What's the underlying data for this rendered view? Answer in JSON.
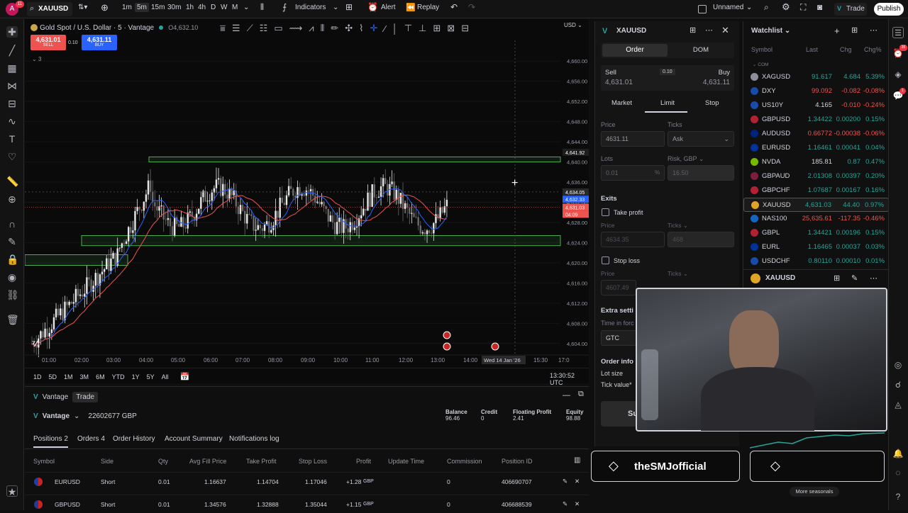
{
  "topbar": {
    "avatar_letter": "A",
    "notif_count": "11",
    "symbol": "XAUUSD",
    "intervals": [
      "1m",
      "5m",
      "15m",
      "30m",
      "1h",
      "4h",
      "D",
      "W",
      "M"
    ],
    "indicators": "Indicators",
    "alert": "Alert",
    "replay": "Replay",
    "layout_name": "Unnamed",
    "trade": "Trade",
    "publish": "Publish"
  },
  "chart": {
    "title": "Gold Spot / U.S. Dollar · 5 · Vantage",
    "ohlc": "O4,632.10",
    "sell_price": "4,631.01",
    "sell_label": "SELL",
    "spread": "0.10",
    "buy_price": "4,631.11",
    "buy_label": "BUY",
    "indicator_count": "3",
    "currency": "USD",
    "y_ticks": [
      "4,660.00",
      "4,656.00",
      "4,652.00",
      "4,648.00",
      "4,644.00",
      "4,640.00",
      "4,636.00",
      "4,632.00",
      "4,628.00",
      "4,624.00",
      "4,620.00",
      "4,616.00",
      "4,612.00",
      "4,608.00",
      "4,604.00"
    ],
    "price_tags": {
      "high": "4,641.92",
      "cross": "4,634.05",
      "bid": "4,632.33",
      "last": "4,631.03",
      "countdown": "04:09"
    },
    "x_ticks": [
      "01:00",
      "02:00",
      "03:00",
      "04:00",
      "05:00",
      "06:00",
      "07:00",
      "08:00",
      "09:00",
      "10:00",
      "11:00",
      "12:00",
      "13:00",
      "14:00",
      "15:30",
      "17:0"
    ],
    "cursor_date": "Wed 14 Jan '26",
    "range_buttons": [
      "1D",
      "5D",
      "1M",
      "3M",
      "6M",
      "YTD",
      "1Y",
      "5Y",
      "All"
    ],
    "clock": "13:30:52 UTC"
  },
  "tradepanel": {
    "broker": "Vantage",
    "trade_tab": "Trade",
    "account": "22602677 GBP",
    "stats": [
      {
        "label": "Balance",
        "value": "96.46"
      },
      {
        "label": "Credit",
        "value": "0"
      },
      {
        "label": "Floating Profit",
        "value": "2.41"
      },
      {
        "label": "Equity",
        "value": "98.88"
      }
    ],
    "tabs": [
      "Positions 2",
      "Orders 4",
      "Order History",
      "Account Summary",
      "Notifications log"
    ],
    "headers": [
      "Symbol",
      "Side",
      "Qty",
      "Avg Fill Price",
      "Take Profit",
      "Stop Loss",
      "Profit",
      "Update Time",
      "Commission",
      "Position ID"
    ],
    "rows": [
      {
        "symbol": "EURUSD",
        "side": "Short",
        "qty": "0.01",
        "avg": "1.16637",
        "tp": "1.14704",
        "sl": "1.17046",
        "profit": "+1.28",
        "cur": "GBP",
        "comm": "0",
        "id": "406690707"
      },
      {
        "symbol": "GBPUSD",
        "side": "Short",
        "qty": "0.01",
        "avg": "1.34576",
        "tp": "1.32888",
        "sl": "1.35044",
        "profit": "+1.15",
        "cur": "GBP",
        "comm": "0",
        "id": "406688539"
      }
    ]
  },
  "orderpanel": {
    "symbol": "XAUUSD",
    "tab_order": "Order",
    "tab_dom": "DOM",
    "sell_label": "Sell",
    "sell_price": "4,631.01",
    "spread": "0.10",
    "buy_label": "Buy",
    "buy_price": "4,631.11",
    "types": [
      "Market",
      "Limit",
      "Stop"
    ],
    "price_label": "Price",
    "price_value": "4631.11",
    "ticks_label": "Ticks",
    "ticks_value": "Ask",
    "lots_label": "Lots",
    "lots_value": "0.01",
    "risk_label": "Risk, GBP",
    "risk_value": "16.50",
    "exits": "Exits",
    "take_profit": "Take profit",
    "tp_price": "4634.35",
    "tp_ticks": "468",
    "stop_loss": "Stop loss",
    "sl_price": "4607.49",
    "extra": "Extra setti",
    "time_in_force": "Time in forc",
    "gtc": "GTC",
    "order_info": "Order info",
    "lot_size": "Lot size",
    "tick_value": "Tick value*",
    "submit": "Su"
  },
  "watchlist": {
    "title": "Watchlist",
    "cols": [
      "Symbol",
      "Last",
      "Chg",
      "Chg%"
    ],
    "section": "COM",
    "rows": [
      {
        "sym": "XAGUSD",
        "last": "91.617",
        "chg": "4.684",
        "pct": "5.39%",
        "dir": "up"
      },
      {
        "sym": "DXY",
        "last": "99.092",
        "chg": "-0.082",
        "pct": "-0.08%",
        "dir": "down"
      },
      {
        "sym": "US10Y",
        "last": "4.165",
        "chg": "-0.010",
        "pct": "-0.24%",
        "dir": "down"
      },
      {
        "sym": "GBPUSD",
        "last": "1.34422",
        "chg": "0.00200",
        "pct": "0.15%",
        "dir": "up"
      },
      {
        "sym": "AUDUSD",
        "last": "0.66772",
        "chg": "-0.00038",
        "pct": "-0.06%",
        "dir": "down"
      },
      {
        "sym": "EURUSD",
        "last": "1.16461",
        "chg": "0.00041",
        "pct": "0.04%",
        "dir": "up"
      },
      {
        "sym": "NVDA",
        "last": "185.81",
        "chg": "0.87",
        "pct": "0.47%",
        "dir": "up"
      },
      {
        "sym": "GBPAUD",
        "last": "2.01308",
        "chg": "0.00397",
        "pct": "0.20%",
        "dir": "up"
      },
      {
        "sym": "GBPCHF",
        "last": "1.07687",
        "chg": "0.00167",
        "pct": "0.16%",
        "dir": "up"
      },
      {
        "sym": "XAUUSD",
        "last": "4,631.03",
        "chg": "44.40",
        "pct": "0.97%",
        "dir": "up"
      },
      {
        "sym": "NAS100",
        "last": "25,635.61",
        "chg": "-117.35",
        "pct": "-0.46%",
        "dir": "down"
      },
      {
        "sym": "GBPL",
        "last": "1.34421",
        "chg": "0.00196",
        "pct": "0.15%",
        "dir": "up"
      },
      {
        "sym": "EURL",
        "last": "1.16465",
        "chg": "0.00037",
        "pct": "0.03%",
        "dir": "up"
      },
      {
        "sym": "USDCHF",
        "last": "0.80110",
        "chg": "0.00010",
        "pct": "0.01%",
        "dir": "up"
      }
    ],
    "detail_symbol": "XAUUSD"
  },
  "overlay": {
    "channel": "theSMJofficial",
    "seasonals": "More seasonals"
  },
  "colors": {
    "green": "#26a69a",
    "red": "#ef5350",
    "blue": "#2962ff",
    "zone": "#4caf50"
  }
}
